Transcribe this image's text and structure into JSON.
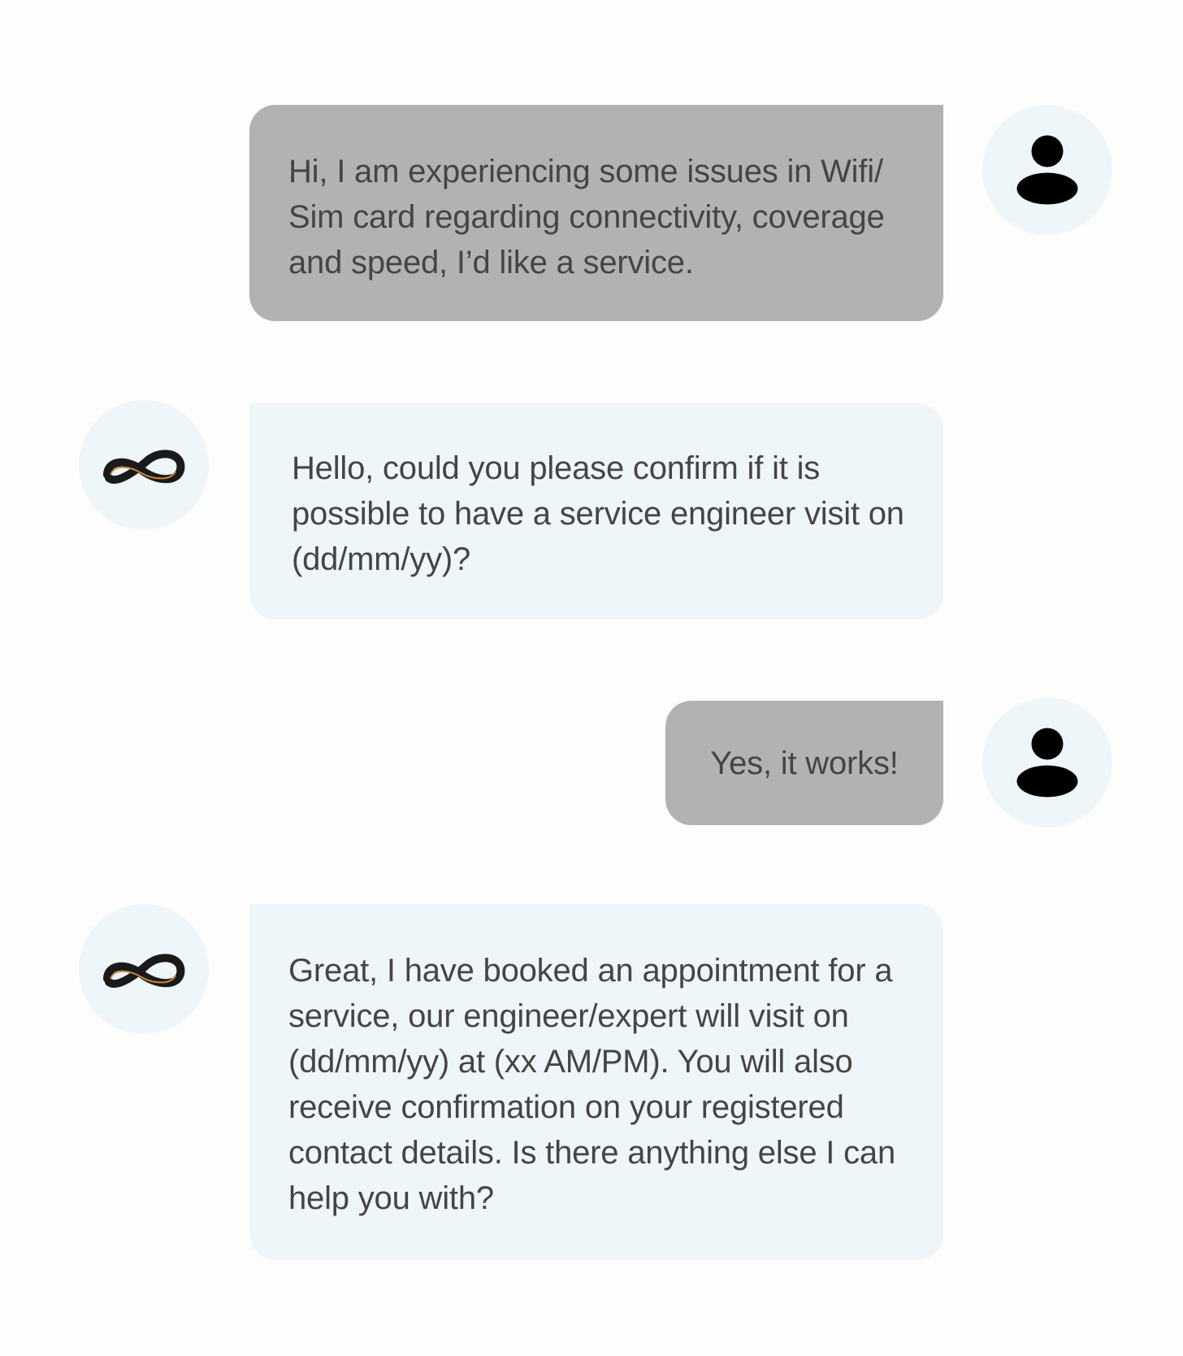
{
  "conversation": {
    "messages": [
      {
        "sender": "user",
        "avatar_icon": "user-icon",
        "text": "Hi, I am experiencing some issues in Wifi/ Sim card regarding connectivity, coverage and speed, I’d like a service."
      },
      {
        "sender": "bot",
        "avatar_icon": "infinity-logo-icon",
        "text": "Hello, could you please confirm if it is possible to have a service engineer visit on (dd/mm/yy)?"
      },
      {
        "sender": "user",
        "avatar_icon": "user-icon",
        "text": "Yes, it works!"
      },
      {
        "sender": "bot",
        "avatar_icon": "infinity-logo-icon",
        "text": "Great, I have booked an appointment for a service, our engineer/expert will visit on (dd/mm/yy) at (xx AM/PM). You will also receive confirmation on your registered contact details. Is there anything else I can help you with?"
      }
    ]
  },
  "colors": {
    "page_background": "#fdfdfd",
    "user_bubble": "#b2b2b2",
    "bot_bubble": "#eff6fa",
    "avatar_background": "#eff6fa",
    "text": "#454545"
  }
}
